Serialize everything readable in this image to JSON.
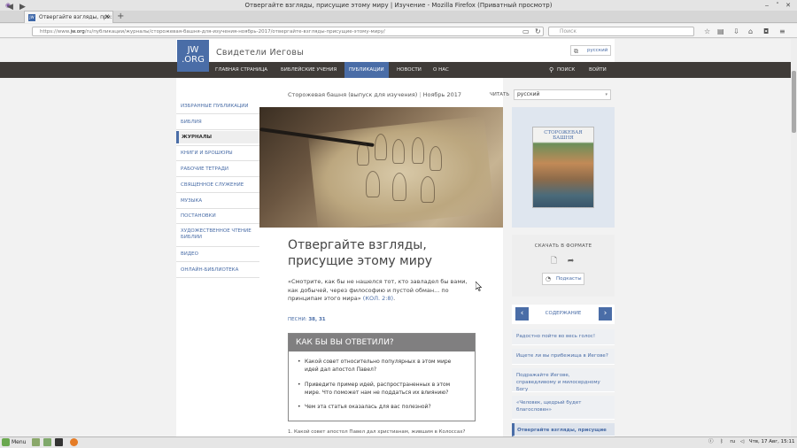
{
  "window": {
    "title": "Отвергайте взгляды, присущие этому миру | Изучение - Mozilla Firefox (Приватный просмотр)"
  },
  "browser": {
    "tab_title": "Отвергайте взгляды, при:",
    "url_prefix": "https://www.",
    "url_domain": "jw.org",
    "url_path": "/ru/публикации/журналы/сторожевая-башня-для-изучения-ноябрь-2017/отвергайте-взгляды-присущие-этому-миру/",
    "search_placeholder": "Поиск"
  },
  "site": {
    "logo_line1": "JW",
    "logo_line2": ".ORG",
    "name": "Свидетели Иеговы",
    "language": "русский"
  },
  "mainnav": {
    "items": [
      "ГЛАВНАЯ СТРАНИЦА",
      "БИБЛЕЙСКИЕ УЧЕНИЯ",
      "ПУБЛИКАЦИИ",
      "НОВОСТИ",
      "О НАС"
    ],
    "search": "ПОИСК",
    "login": "ВОЙТИ"
  },
  "sidebar": {
    "items": [
      "ИЗБРАННЫЕ ПУБЛИКАЦИИ",
      "БИБЛИЯ",
      "ЖУРНАЛЫ",
      "КНИГИ И БРОШЮРЫ",
      "РАБОЧИЕ ТЕТРАДИ",
      "СВЯЩЕННОЕ СЛУЖЕНИЕ",
      "МУЗЫКА",
      "ПОСТАНОВКИ",
      "ХУДОЖЕСТВЕННОЕ ЧТЕНИЕ БИБЛИИ",
      "ВИДЕО",
      "ОНЛАЙН-БИБЛИОТЕКА"
    ],
    "active": "ЖУРНАЛЫ"
  },
  "article": {
    "publication": "Сторожевая башня (выпуск для изучения)",
    "issue": "Ноябрь 2017",
    "read_label": "ЧИТАТЬ",
    "read_value": "русский",
    "title_line1": "Отвергайте взгляды,",
    "title_line2": "присущие этому миру",
    "quote": "«Смотрите, как бы не нашелся тот, кто завладел бы вами, как добычей, через философию и пустой обман... по принципам этого мира»",
    "quote_ref": "(КОЛ. 2:8)",
    "songs_label": "ПЕСНИ:",
    "songs_numbers": "38, 31",
    "qbox_title": "КАК БЫ ВЫ ОТВЕТИЛИ?",
    "questions": [
      "Какой совет относительно популярных в этом мире идей дал апостол Павел?",
      "Приведите пример идей, распространенных в этом мире. Что поможет нам не поддаться их влиянию?",
      "Чем эта статья оказалась для вас полезной?"
    ],
    "footer_question": "1. Какой совет апостол Павел дал христианам, жившим в Колоссах?"
  },
  "right": {
    "cover_title": "СТОРОЖЕВАЯ БАШНЯ",
    "download_title": "СКАЧАТЬ В ФОРМАТЕ",
    "podcast": "Подкасты",
    "toc_label": "СОДЕРЖАНИЕ",
    "toc_items": [
      "Радостно пойте во весь голос!",
      "Ищете ли вы прибежища в Иегове?",
      "Подражайте Иегове, справедливому и милосердному Богу",
      "«Человек, щедрый будет благословен»",
      "Отвергайте взгляды, присущие"
    ]
  },
  "taskbar": {
    "menu": "Menu",
    "lang": "ru",
    "datetime": "Чтв, 17 Авг, 15:11"
  },
  "colors": {
    "accent": "#4a6da7",
    "nav_dark": "#3f3b38"
  }
}
